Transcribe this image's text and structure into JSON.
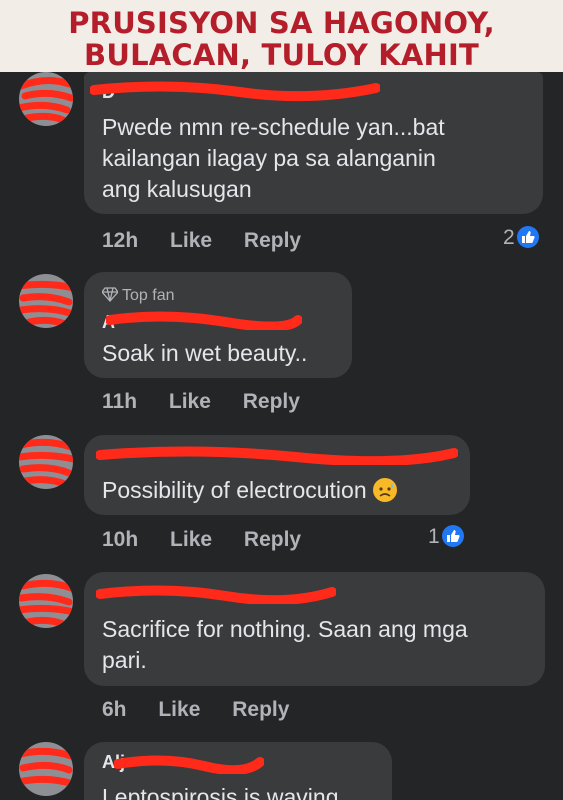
{
  "banner": {
    "line1": "PRUSISYON SA HAGONOY,",
    "line2": "BULACAN, TULOY KAHIT"
  },
  "colors": {
    "background": "#242526",
    "bubble": "#3a3b3c",
    "text": "#e4e6eb",
    "muted": "#b0b3b8",
    "like_blue": "#2078f4",
    "redaction": "#ff2a1a",
    "banner_red": "#b41e2a"
  },
  "comments": [
    {
      "name_partial": "D",
      "text_lines": [
        "Pwede nmn re-schedule yan...bat",
        "kailangan ilagay pa sa alanganin",
        "ang kalusugan"
      ],
      "time": "12h",
      "like_label": "Like",
      "reply_label": "Reply",
      "reactions": "2",
      "reaction_icon": "like-icon"
    },
    {
      "badge": "Top fan",
      "badge_icon": "diamond-icon",
      "name_partial": "A",
      "text_lines": [
        "Soak in wet beauty.."
      ],
      "time": "11h",
      "like_label": "Like",
      "reply_label": "Reply"
    },
    {
      "name_partial": "",
      "text_lines": [
        "Possibility of electrocution"
      ],
      "emoji": "sad-sweat-emoji",
      "time": "10h",
      "like_label": "Like",
      "reply_label": "Reply",
      "reactions": "1",
      "reaction_icon": "like-icon"
    },
    {
      "name_partial": "",
      "text_lines": [
        "Sacrifice for nothing. Saan ang mga",
        "pari."
      ],
      "time": "6h",
      "like_label": "Like",
      "reply_label": "Reply"
    },
    {
      "name_partial": "Alj",
      "text_lines": [
        "Leptospirosis is waving"
      ]
    }
  ]
}
